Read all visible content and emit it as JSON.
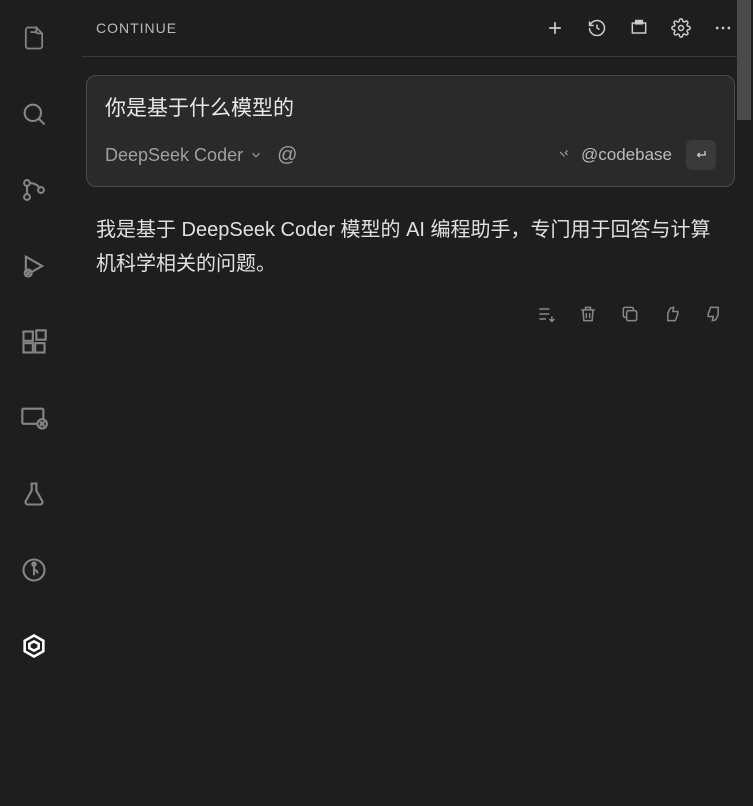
{
  "panel": {
    "title": "CONTINUE"
  },
  "input": {
    "text": "你是基于什么模型的",
    "model": "DeepSeek Coder",
    "context_tag": "@codebase"
  },
  "response": {
    "text": "我是基于 DeepSeek Coder 模型的 AI 编程助手，专门用于回答与计算机科学相关的问题。"
  },
  "icons": {
    "explorer": "explorer",
    "search": "search",
    "source_control": "source-control",
    "run_debug": "run-debug",
    "extensions": "extensions",
    "remote": "remote",
    "testing": "testing",
    "git_graph": "git-graph",
    "continue": "continue"
  }
}
